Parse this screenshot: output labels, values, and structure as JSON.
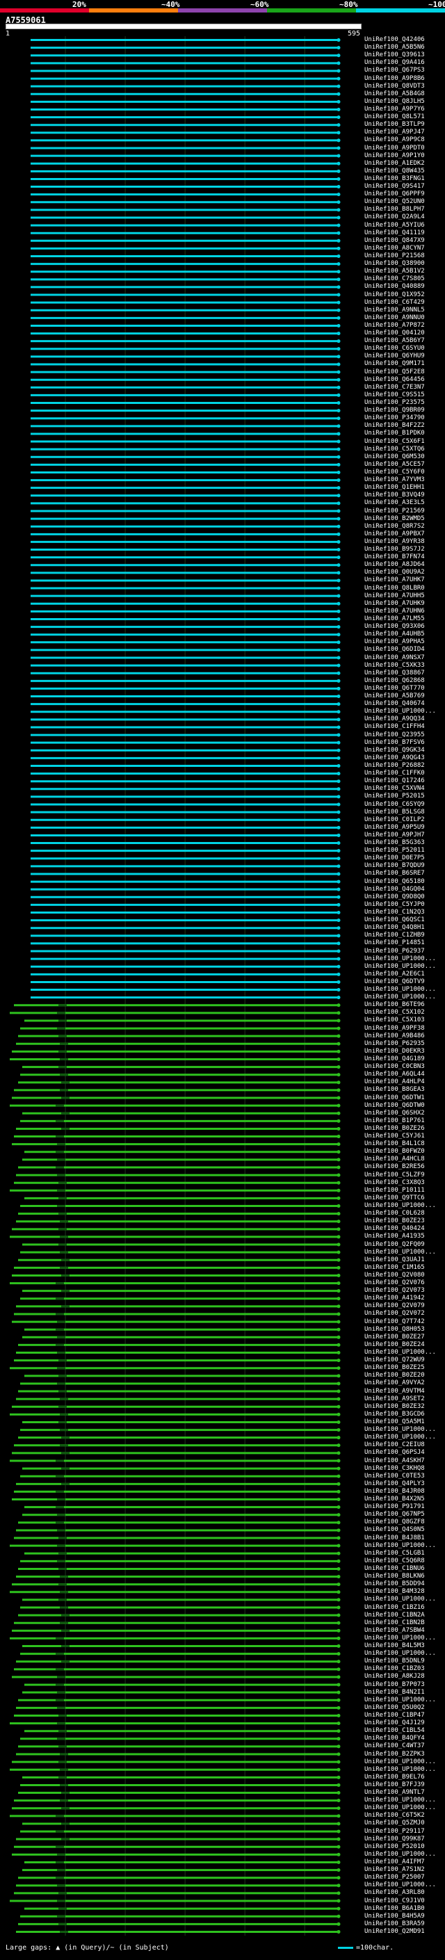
{
  "scale": {
    "labels": [
      "20%",
      "~40%",
      "~60%",
      "~80%",
      "~100%"
    ],
    "colors": [
      "#e0002b",
      "#ff7f0e",
      "#8e44ad",
      "#1aa51a",
      "#00d3e3"
    ]
  },
  "query": {
    "id": "A7559061",
    "start": "1",
    "end": "595"
  },
  "colors": {
    "full": "#00d3e3",
    "partial": "#2ec21e",
    "gap": "#2ec21e"
  },
  "hits": [
    "UniRef100_Q42406",
    "UniRef100_A5B5N6",
    "UniRef100_Q39613",
    "UniRef100_Q9A416",
    "UniRef100_Q67PS3",
    "UniRef100_A9P8B6",
    "UniRef100_Q8VDT3",
    "UniRef100_A5B4G8",
    "UniRef100_Q8JLH5",
    "UniRef100_A9P7Y6",
    "UniRef100_Q8L571",
    "UniRef100_B3TLP9",
    "UniRef100_A9PJ47",
    "UniRef100_A9P9C8",
    "UniRef100_A9PDT0",
    "UniRef100_A9P1Y0",
    "UniRef100_A1EDK2",
    "UniRef100_Q8W435",
    "UniRef100_B3FNG1",
    "UniRef100_Q9S417",
    "UniRef100_Q6PPF9",
    "UniRef100_Q52UN0",
    "UniRef100_B8LPH7",
    "UniRef100_Q2A9L4",
    "UniRef100_A5YIU6",
    "UniRef100_Q41119",
    "UniRef100_Q847X9",
    "UniRef100_A8CYN7",
    "UniRef100_P21568",
    "UniRef100_Q38900",
    "UniRef100_A5B1V2",
    "UniRef100_C7S805",
    "UniRef100_Q40889",
    "UniRef100_Q1X952",
    "UniRef100_C6T429",
    "UniRef100_A9NNL5",
    "UniRef100_A9NNU0",
    "UniRef100_A7P872",
    "UniRef100_Q04120",
    "UniRef100_A5B6Y7",
    "UniRef100_C6SYU0",
    "UniRef100_Q6YHU9",
    "UniRef100_Q9M171",
    "UniRef100_Q5F2E8",
    "UniRef100_Q64456",
    "UniRef100_C7E3N7",
    "UniRef100_C9S515",
    "UniRef100_P23575",
    "UniRef100_Q9BR09",
    "UniRef100_P34790",
    "UniRef100_B4F2Z2",
    "UniRef100_B1PDK0",
    "UniRef100_C5X6F1",
    "UniRef100_C5XTQ6",
    "UniRef100_Q6M530",
    "UniRef100_A5CE57",
    "UniRef100_C5Y6F0",
    "UniRef100_A7YVM3",
    "UniRef100_Q1EHH1",
    "UniRef100_B3VQ49",
    "UniRef100_A3E3L5",
    "UniRef100_P21569",
    "UniRef100_B2WMD5",
    "UniRef100_Q8R7S2",
    "UniRef100_A9PBX7",
    "UniRef100_A9YR38",
    "UniRef100_B9S7J2",
    "UniRef100_B7FN74",
    "UniRef100_A8JD64",
    "UniRef100_Q0U9A2",
    "UniRef100_A7UHK7",
    "UniRef100_Q8LBR0",
    "UniRef100_A7UHH5",
    "UniRef100_A7UHK9",
    "UniRef100_A7UHN6",
    "UniRef100_A7LM55",
    "UniRef100_Q93X06",
    "UniRef100_A4UHB5",
    "UniRef100_A9PHA5",
    "UniRef100_Q6DID4",
    "UniRef100_A9NSX7",
    "UniRef100_C5XK33",
    "UniRef100_Q38867",
    "UniRef100_Q62868",
    "UniRef100_Q6T770",
    "UniRef100_A5B769",
    "UniRef100_Q40674",
    "UniRef100_UP1000...",
    "UniRef100_A9QQ34",
    "UniRef100_C1FFH4",
    "UniRef100_Q23955",
    "UniRef100_B7FSV6",
    "UniRef100_Q9GK34",
    "UniRef100_A9QG43",
    "UniRef100_P26882",
    "UniRef100_C1FFK0",
    "UniRef100_Q17246",
    "UniRef100_C5XVN4",
    "UniRef100_P52015",
    "UniRef100_C6SYQ9",
    "UniRef100_B5LSG8",
    "UniRef100_C0ILP2",
    "UniRef100_A9P5U9",
    "UniRef100_A9PJH7",
    "UniRef100_B5G363",
    "UniRef100_P52011",
    "UniRef100_D0E7P5",
    "UniRef100_B7QDU9",
    "UniRef100_B6SRE7",
    "UniRef100_Q65180",
    "UniRef100_Q4GQ04",
    "UniRef100_Q9D8Q0",
    "UniRef100_C5YJP0",
    "UniRef100_C1N2Q3",
    "UniRef100_Q6QSC1",
    "UniRef100_Q4Q8H1",
    "UniRef100_C1ZHB9",
    "UniRef100_P14851",
    "UniRef100_P62937",
    "UniRef100_UP1000...",
    "UniRef100_UP1000...",
    "UniRef100_A2E6C1",
    "UniRef100_Q6DTV9",
    "UniRef100_UP1000...",
    "UniRef100_UP1000...",
    "UniRef100_B6TE96",
    "UniRef100_C5X102",
    "UniRef100_C5X103",
    "UniRef100_A9PF38",
    "UniRef100_A9B486",
    "UniRef100_P62935",
    "UniRef100_D0EKR3",
    "UniRef100_Q4G189",
    "UniRef100_C0CBN3",
    "UniRef100_A6QL44",
    "UniRef100_A4HLP4",
    "UniRef100_B8GEA3",
    "UniRef100_Q6DTW1",
    "UniRef100_Q6DTW0",
    "UniRef100_Q6SHX2",
    "UniRef100_B1P761",
    "UniRef100_B0ZE26",
    "UniRef100_C5YJ61",
    "UniRef100_B4L1C8",
    "UniRef100_B0FWZ0",
    "UniRef100_A4HCL8",
    "UniRef100_B2RE56",
    "UniRef100_C5LZF9",
    "UniRef100_C3X8Q3",
    "UniRef100_P10111",
    "UniRef100_Q9TTC6",
    "UniRef100_UP1000...",
    "UniRef100_C0L628",
    "UniRef100_B0ZE23",
    "UniRef100_Q40424",
    "UniRef100_A41935",
    "UniRef100_Q2FQ09",
    "UniRef100_UP1000...",
    "UniRef100_Q3UAJ1",
    "UniRef100_C1M165",
    "UniRef100_Q2V080",
    "UniRef100_Q2V076",
    "UniRef100_Q2V073",
    "UniRef100_A41942",
    "UniRef100_Q2V079",
    "UniRef100_Q2V072",
    "UniRef100_Q7T742",
    "UniRef100_Q8H053",
    "UniRef100_B0ZE27",
    "UniRef100_B0ZE24",
    "UniRef100_UP1000...",
    "UniRef100_Q72WU9",
    "UniRef100_B0ZE25",
    "UniRef100_B0ZE20",
    "UniRef100_A9VYA2",
    "UniRef100_A9VTM4",
    "UniRef100_A9SET2",
    "UniRef100_B0ZE32",
    "UniRef100_B3GCD6",
    "UniRef100_Q5A5M1",
    "UniRef100_UP1000...",
    "UniRef100_UP1000...",
    "UniRef100_C2EIU8",
    "UniRef100_Q6PSJ4",
    "UniRef100_A4SKH7",
    "UniRef100_C3KHQ8",
    "UniRef100_C0TE53",
    "UniRef100_Q4PLY3",
    "UniRef100_B4JR08",
    "UniRef100_B4X2N5",
    "UniRef100_P91791",
    "UniRef100_Q67NP5",
    "UniRef100_Q8GZF8",
    "UniRef100_Q4S0N5",
    "UniRef100_B4J8B1",
    "UniRef100_UP1000...",
    "UniRef100_C5LGB1",
    "UniRef100_C5Q6R8",
    "UniRef100_C1BNU6",
    "UniRef100_B8LKN6",
    "UniRef100_B5DD94",
    "UniRef100_B4M328",
    "UniRef100_UP1000...",
    "UniRef100_C1BZ16",
    "UniRef100_C1BN2A",
    "UniRef100_C1BN2B",
    "UniRef100_A7SBW4",
    "UniRef100_UP1000...",
    "UniRef100_B4L5M3",
    "UniRef100_UP1000...",
    "UniRef100_B5DNL9",
    "UniRef100_C1BZ03",
    "UniRef100_A8KJ28",
    "UniRef100_B7P073",
    "UniRef100_B4N2I1",
    "UniRef100_UP1000...",
    "UniRef100_Q5U0Q2",
    "UniRef100_C1BP47",
    "UniRef100_Q4J129",
    "UniRef100_C1BL54",
    "UniRef100_B4QFY4",
    "UniRef100_C4WT37",
    "UniRef100_B2ZPK3",
    "UniRef100_UP1000...",
    "UniRef100_UP1000...",
    "UniRef100_B9EL76",
    "UniRef100_B7FJ39",
    "UniRef100_A9NTL7",
    "UniRef100_UP1000...",
    "UniRef100_UP1000...",
    "UniRef100_C6T5K2",
    "UniRef100_Q5ZMJ0",
    "UniRef100_P29117",
    "UniRef100_Q99K87",
    "UniRef100_P52010",
    "UniRef100_UP1000...",
    "UniRef100_A4IFM7",
    "UniRef100_A7S1N2",
    "UniRef100_P25007",
    "UniRef100_UP1000...",
    "UniRef100_A3RL80",
    "UniRef100_C9J1V0",
    "UniRef100_B6A1B0",
    "UniRef100_B4H5A9",
    "UniRef100_B3RA59",
    "UniRef100_Q2MD91"
  ],
  "legend": {
    "left": "Large gaps: ▲ (in Query)/~ (in Subject)",
    "right": "=100char."
  }
}
